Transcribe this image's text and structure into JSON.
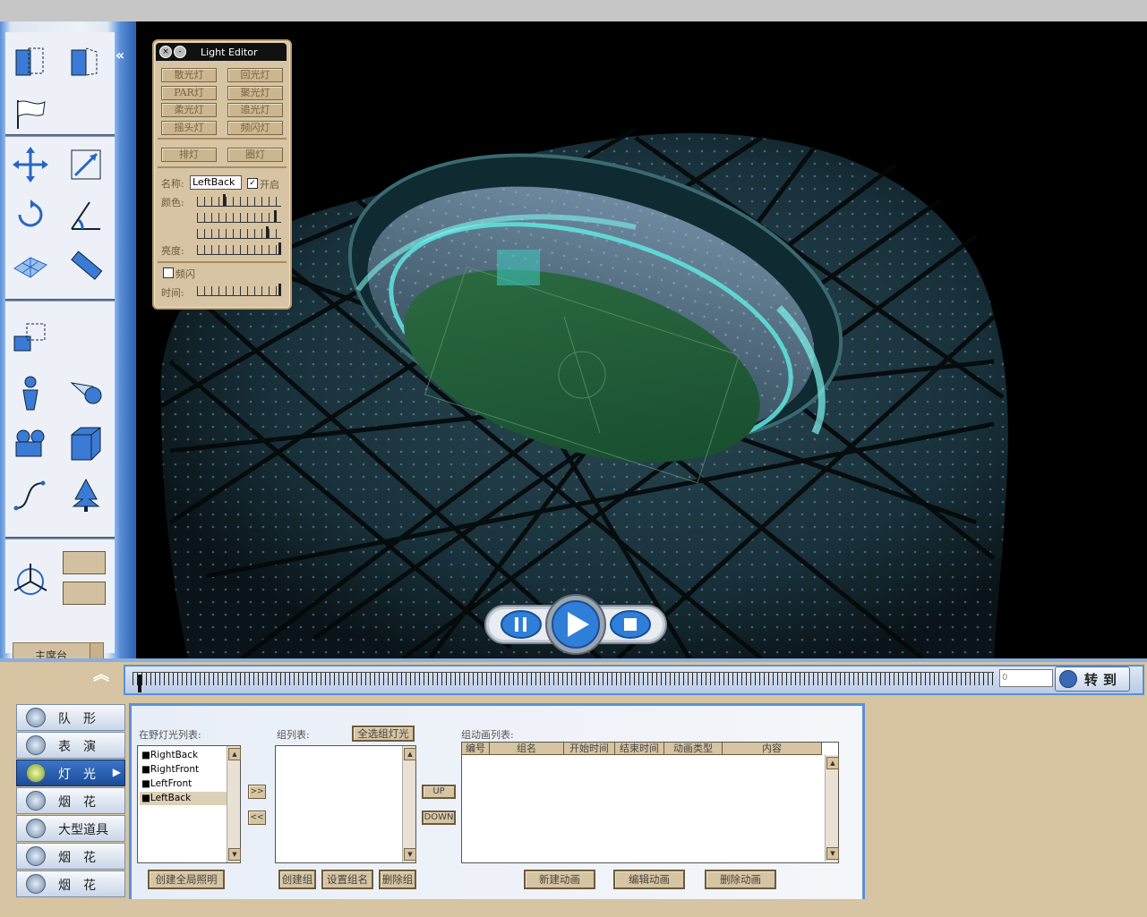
{
  "light_editor": {
    "title": "Light Editor",
    "light_types": [
      "散光灯",
      "回光灯",
      "PAR灯",
      "聚光灯",
      "柔光灯",
      "追光灯",
      "摇头灯",
      "频闪灯"
    ],
    "group_buttons": [
      "排灯",
      "圈灯"
    ],
    "name_label": "名称:",
    "name_value": "LeftBack",
    "enable_label": "开启",
    "enable_checked": true,
    "color_label": "颜色:",
    "color_levels": [
      0.32,
      0.95,
      0.85
    ],
    "brightness_label": "亮度:",
    "brightness_level": 1.0,
    "strobe_label": "频闪",
    "strobe_checked": false,
    "time_label": "时间:",
    "time_level": 1.0
  },
  "toolbar": {
    "main_stage_label": "主席台"
  },
  "playback": {
    "frame_value": "0",
    "goto_label": "转到"
  },
  "categories": [
    {
      "label": "队形",
      "active": false
    },
    {
      "label": "表演",
      "active": false
    },
    {
      "label": "灯光",
      "active": true
    },
    {
      "label": "烟花",
      "active": false
    },
    {
      "label": "大型道具",
      "active": false
    },
    {
      "label": "烟花",
      "active": false
    },
    {
      "label": "烟花",
      "active": false
    }
  ],
  "lights_panel": {
    "field_lights_label": "在野灯光列表:",
    "field_lights": [
      "RightBack",
      "RightFront",
      "LeftFront",
      "LeftBack"
    ],
    "selected_light": "LeftBack",
    "group_list_label": "组列表:",
    "select_all_label": "全选组灯光",
    "move_right": ">>",
    "move_left": "<<",
    "up_label": "UP",
    "down_label": "DOWN",
    "group_anim_label": "组动画列表:",
    "anim_columns": [
      "编号",
      "组名",
      "开始时间",
      "结束时间",
      "动画类型",
      "内容"
    ],
    "create_global_label": "创建全局照明",
    "create_group_label": "创建组",
    "set_group_name_label": "设置组名",
    "delete_group_label": "删除组",
    "new_anim_label": "新建动画",
    "edit_anim_label": "编辑动画",
    "delete_anim_label": "删除动画"
  },
  "colors": {
    "accent_blue": "#5c8fd6",
    "panel_tan": "#d6c4a2",
    "viewport_bg": "#000000",
    "pitch_green": "#1f5a36",
    "glow_cyan": "#5fe6e0"
  }
}
